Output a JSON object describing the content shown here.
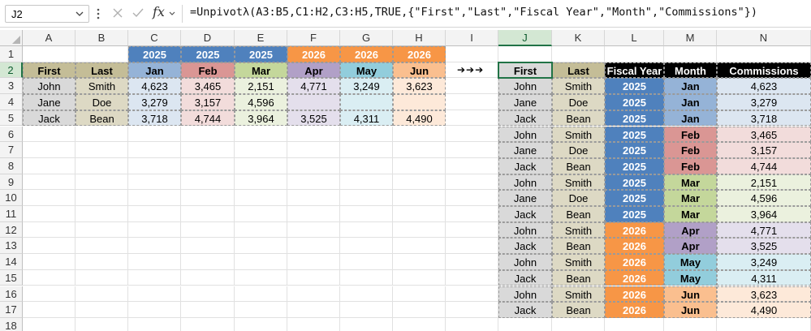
{
  "formula_bar": {
    "name_box": "J2",
    "formula": "=Unpivotλ(A3:B5,C1:H2,C3:H5,TRUE,{\"First\",\"Last\",\"Fiscal Year\",\"Month\",\"Commissions\"})",
    "fx_label": "fx"
  },
  "columns": [
    "A",
    "B",
    "C",
    "D",
    "E",
    "F",
    "G",
    "H",
    "I",
    "J",
    "K",
    "L",
    "M",
    "N"
  ],
  "rows": [
    "1",
    "2",
    "3",
    "4",
    "5",
    "6",
    "7",
    "8",
    "9",
    "10",
    "11",
    "12",
    "13",
    "14",
    "15",
    "16",
    "17",
    "18"
  ],
  "selected_column": "J",
  "selected_row": "2",
  "arrows_text": "➔➔➔",
  "colors": {
    "year2025": "#4f81bd",
    "year2026": "#f79646",
    "name_header": "#c4bd97",
    "name_cell": "#d9d9d9",
    "last_cell": "#ddd9c4",
    "jan": "#95b3d7",
    "jan_light": "#dce6f1",
    "feb": "#da9694",
    "feb_light": "#f2dcdb",
    "mar": "#c4d79b",
    "mar_light": "#ebf1de",
    "apr": "#b1a0c7",
    "apr_light": "#e4dfec",
    "may": "#92cddc",
    "may_light": "#daeef3",
    "jun": "#fabf8f",
    "jun_light": "#fde9d9",
    "black_header": "#000000"
  },
  "source": {
    "years": [
      "2025",
      "2025",
      "2025",
      "2026",
      "2026",
      "2026"
    ],
    "headers": [
      "First",
      "Last",
      "Jan",
      "Feb",
      "Mar",
      "Apr",
      "May",
      "Jun"
    ],
    "rows": [
      [
        "John",
        "Smith",
        "4,623",
        "3,465",
        "2,151",
        "4,771",
        "3,249",
        "3,623"
      ],
      [
        "Jane",
        "Doe",
        "3,279",
        "3,157",
        "4,596",
        "",
        "",
        ""
      ],
      [
        "Jack",
        "Bean",
        "3,718",
        "4,744",
        "3,964",
        "3,525",
        "4,311",
        "4,490"
      ]
    ]
  },
  "result": {
    "headers": [
      "First",
      "Last",
      "Fiscal Year",
      "Month",
      "Commissions"
    ],
    "rows": [
      [
        "John",
        "Smith",
        "2025",
        "Jan",
        "4,623"
      ],
      [
        "Jane",
        "Doe",
        "2025",
        "Jan",
        "3,279"
      ],
      [
        "Jack",
        "Bean",
        "2025",
        "Jan",
        "3,718"
      ],
      [
        "John",
        "Smith",
        "2025",
        "Feb",
        "3,465"
      ],
      [
        "Jane",
        "Doe",
        "2025",
        "Feb",
        "3,157"
      ],
      [
        "Jack",
        "Bean",
        "2025",
        "Feb",
        "4,744"
      ],
      [
        "John",
        "Smith",
        "2025",
        "Mar",
        "2,151"
      ],
      [
        "Jane",
        "Doe",
        "2025",
        "Mar",
        "4,596"
      ],
      [
        "Jack",
        "Bean",
        "2025",
        "Mar",
        "3,964"
      ],
      [
        "John",
        "Smith",
        "2026",
        "Apr",
        "4,771"
      ],
      [
        "Jack",
        "Bean",
        "2026",
        "Apr",
        "3,525"
      ],
      [
        "John",
        "Smith",
        "2026",
        "May",
        "3,249"
      ],
      [
        "Jack",
        "Bean",
        "2026",
        "May",
        "4,311"
      ],
      [
        "John",
        "Smith",
        "2026",
        "Jun",
        "3,623"
      ],
      [
        "Jack",
        "Bean",
        "2026",
        "Jun",
        "4,490"
      ]
    ]
  }
}
